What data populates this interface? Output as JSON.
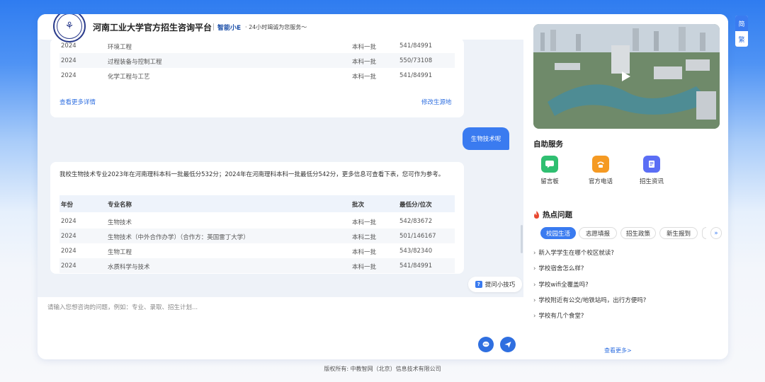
{
  "header": {
    "site_title": "河南工业大学官方招生咨询平台",
    "bot_name": "智能小E",
    "slogan": "· 24小时竭诚为您服务～"
  },
  "message1": {
    "rows": [
      {
        "year": "2024",
        "major": "环境工程",
        "batch": "本科一批",
        "score": "541/84991"
      },
      {
        "year": "2024",
        "major": "过程装备与控制工程",
        "batch": "本科一批",
        "score": "550/73108"
      },
      {
        "year": "2024",
        "major": "化学工程与工艺",
        "batch": "本科一批",
        "score": "541/84991"
      }
    ],
    "more_link": "查看更多详情",
    "change_region_link": "修改生源地"
  },
  "user_message": "生物技术呢",
  "message2": {
    "intro": "我校生物技术专业2023年在河南理科本科一批最低分532分；2024年在河南理科本科一批最低分542分，更多信息可查看下表，您可作为参考。",
    "columns": [
      "年份",
      "专业名称",
      "批次",
      "最低分/位次"
    ],
    "rows": [
      {
        "year": "2024",
        "major": "生物技术",
        "batch": "本科一批",
        "score": "542/83672"
      },
      {
        "year": "2024",
        "major": "生物技术（中外合作办学）（合作方：英国雷丁大学）",
        "batch": "本科二批",
        "score": "501/146167"
      },
      {
        "year": "2024",
        "major": "生物工程",
        "batch": "本科一批",
        "score": "543/82340"
      },
      {
        "year": "2024",
        "major": "水质科学与技术",
        "batch": "本科一批",
        "score": "541/84991"
      }
    ]
  },
  "tips_button": "提问小技巧",
  "input": {
    "placeholder": "请输入您想咨询的问题，例如：专业、录取、招生计划..."
  },
  "side": {
    "self_service_title": "自助服务",
    "services": [
      {
        "label": "留言板",
        "icon": "message-board-icon",
        "color": "#2fbf71"
      },
      {
        "label": "官方电话",
        "icon": "phone-icon",
        "color": "#f59a23"
      },
      {
        "label": "招生资讯",
        "icon": "news-icon",
        "color": "#5b6ef5"
      }
    ],
    "hot_title": "热点问题",
    "tabs": [
      "校园生活",
      "志愿填报",
      "招生政策",
      "新生报到"
    ],
    "questions": [
      "新入学学生在哪个校区就读?",
      "学校宿舍怎么样?",
      "学校wifi全覆盖吗?",
      "学校附近有公交/地铁站吗，出行方便吗?",
      "学校有几个食堂?"
    ],
    "more_link": "查看更多>"
  },
  "lang": {
    "simplified": "简",
    "traditional": "繁"
  },
  "footer": "版权所有: 中教智网（北京）信息技术有限公司",
  "colors": {
    "accent": "#3a7bf0",
    "link": "#2f6fe0"
  }
}
